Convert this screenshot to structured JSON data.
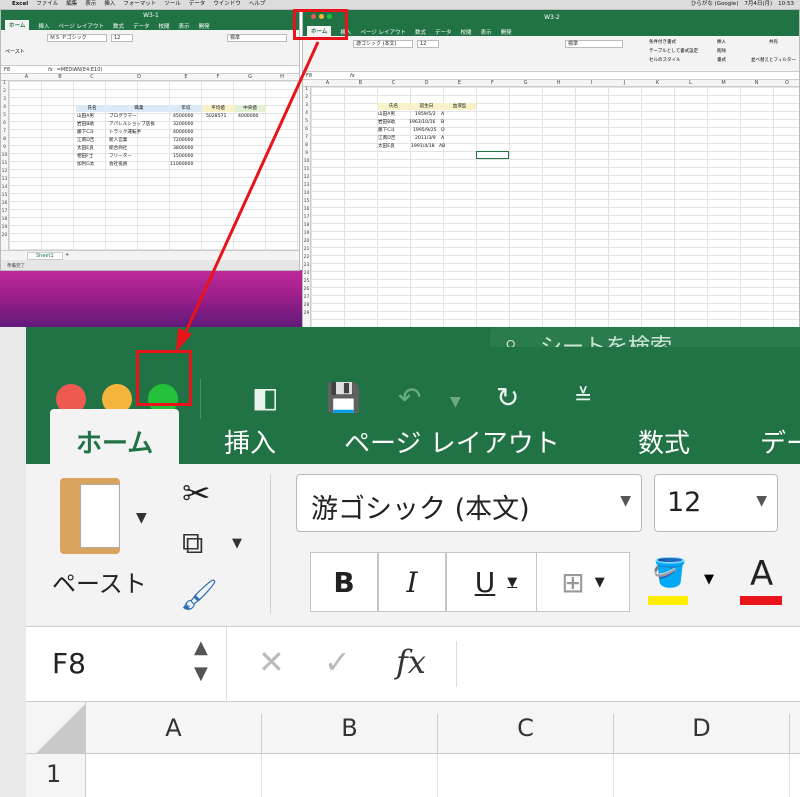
{
  "menubar": {
    "items": [
      "Excel",
      "ファイル",
      "編集",
      "表示",
      "挿入",
      "フォーマット",
      "ツール",
      "データ",
      "ウインドウ",
      "ヘルプ"
    ],
    "status_right": [
      "ひらがな (Google)",
      "7月4日(月)",
      "10:53"
    ]
  },
  "win1": {
    "title": "W3-1",
    "tabs": [
      "ホーム",
      "挿入",
      "ページ レイアウト",
      "数式",
      "データ",
      "校閲",
      "表示",
      "開発"
    ],
    "font_name": "ＭＳ Ｐゴシック",
    "font_size": "12",
    "number_format": "標準",
    "paste_label": "ペースト",
    "cell_ref": "F8",
    "formula": "=MEDIAN(E4:E10)",
    "columns": [
      "A",
      "B",
      "C",
      "D",
      "E",
      "F",
      "G",
      "H"
    ],
    "rows": [
      "1",
      "2",
      "3",
      "4",
      "5",
      "6",
      "7",
      "8",
      "9",
      "10",
      "11",
      "12",
      "13",
      "14",
      "15",
      "16",
      "17",
      "18",
      "19",
      "20"
    ],
    "table_headers": [
      "氏名",
      "職業",
      "年収",
      "平均値",
      "中央値"
    ],
    "table_rows": [
      [
        "山田A男",
        "プログラマー",
        "4500000",
        "5028571",
        "4000000"
      ],
      [
        "岩田B助",
        "アパレルショップ店長",
        "3200000",
        "",
        ""
      ],
      [
        "藤下C斗",
        "トラック運転手",
        "4000000",
        "",
        ""
      ],
      [
        "江南D吉",
        "新人営業",
        "7200000",
        "",
        ""
      ],
      [
        "太田E良",
        "総合商社",
        "3800000",
        "",
        ""
      ],
      [
        "相田F士",
        "フリーター",
        "1500000",
        "",
        ""
      ],
      [
        "加利G太",
        "会社役員",
        "11000000",
        "",
        ""
      ]
    ],
    "sheet_tab": "Sheet1",
    "status": "準備完了"
  },
  "win2": {
    "title": "W3-2",
    "tabs": [
      "ホーム",
      "挿入",
      "ページ レイアウト",
      "数式",
      "データ",
      "校閲",
      "表示",
      "開発"
    ],
    "font_name": "游ゴシック (本文)",
    "font_size": "12",
    "number_format": "標準",
    "ribbon_right": [
      "条件付き書式",
      "テーブルとして書式設定",
      "セルのスタイル",
      "挿入",
      "削除",
      "書式",
      "並べ替えとフィルター",
      "共有"
    ],
    "cell_ref": "F8",
    "fx": "fx",
    "columns": [
      "A",
      "B",
      "C",
      "D",
      "E",
      "F",
      "G",
      "H",
      "I",
      "J",
      "K",
      "L",
      "M",
      "N",
      "O"
    ],
    "rows": [
      "1",
      "2",
      "3",
      "4",
      "5",
      "6",
      "7",
      "8",
      "9",
      "10",
      "11",
      "12",
      "13",
      "14",
      "15",
      "16",
      "17",
      "18",
      "19",
      "20",
      "21",
      "22",
      "23",
      "24",
      "25",
      "26",
      "27",
      "28",
      "29"
    ],
    "table_headers": [
      "氏名",
      "誕生日",
      "血液型"
    ],
    "table_rows": [
      [
        "山田A男",
        "1959/5/2",
        "A"
      ],
      [
        "岩田B助",
        "1963/10/16",
        "B"
      ],
      [
        "藤下C斗",
        "1995/9/25",
        "O"
      ],
      [
        "江南D吉",
        "2011/3/9",
        "A"
      ],
      [
        "太田E良",
        "1991/4/18",
        "AB"
      ]
    ]
  },
  "zoom": {
    "tabs": [
      "ホーム",
      "挿入",
      "ページ レイアウト",
      "数式",
      "デー"
    ],
    "paste_label": "ペースト",
    "font_name": "游ゴシック (本文)",
    "font_size": "12",
    "bold": "B",
    "italic": "I",
    "underline": "U",
    "font_color_glyph": "A",
    "cell_ref": "F8",
    "fx": "fx",
    "columns": [
      "A",
      "B",
      "C",
      "D"
    ],
    "row1": "1",
    "search_hint": "シートを検索"
  },
  "colors": {
    "excel_green": "#217346",
    "highlight_red": "#e8141a",
    "tl_red": "#ee5a52",
    "tl_yellow": "#f5b53c",
    "tl_green": "#23c23a"
  }
}
